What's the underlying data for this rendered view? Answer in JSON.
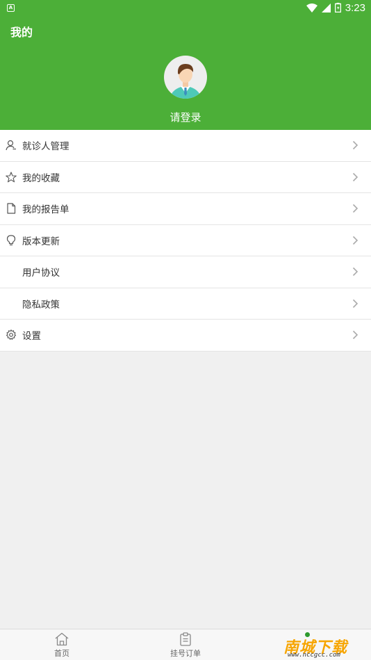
{
  "status": {
    "time": "3:23"
  },
  "header": {
    "title": "我的",
    "login_label": "请登录"
  },
  "menu": [
    {
      "label": "就诊人管理",
      "icon": "user-icon"
    },
    {
      "label": "我的收藏",
      "icon": "star-icon"
    },
    {
      "label": "我的报告单",
      "icon": "file-icon"
    },
    {
      "label": "版本更新",
      "icon": "bulb-icon"
    },
    {
      "label": "用户协议",
      "icon": ""
    },
    {
      "label": "隐私政策",
      "icon": ""
    },
    {
      "label": "设置",
      "icon": "gear-icon"
    }
  ],
  "tabs": [
    {
      "label": "首页",
      "icon": "home-icon"
    },
    {
      "label": "挂号订单",
      "icon": "clipboard-icon"
    }
  ],
  "watermark": {
    "brand": "南城下载",
    "url": "www.nccgcc.com"
  },
  "colors": {
    "primary": "#4caf38",
    "watermark": "#f7a500"
  }
}
